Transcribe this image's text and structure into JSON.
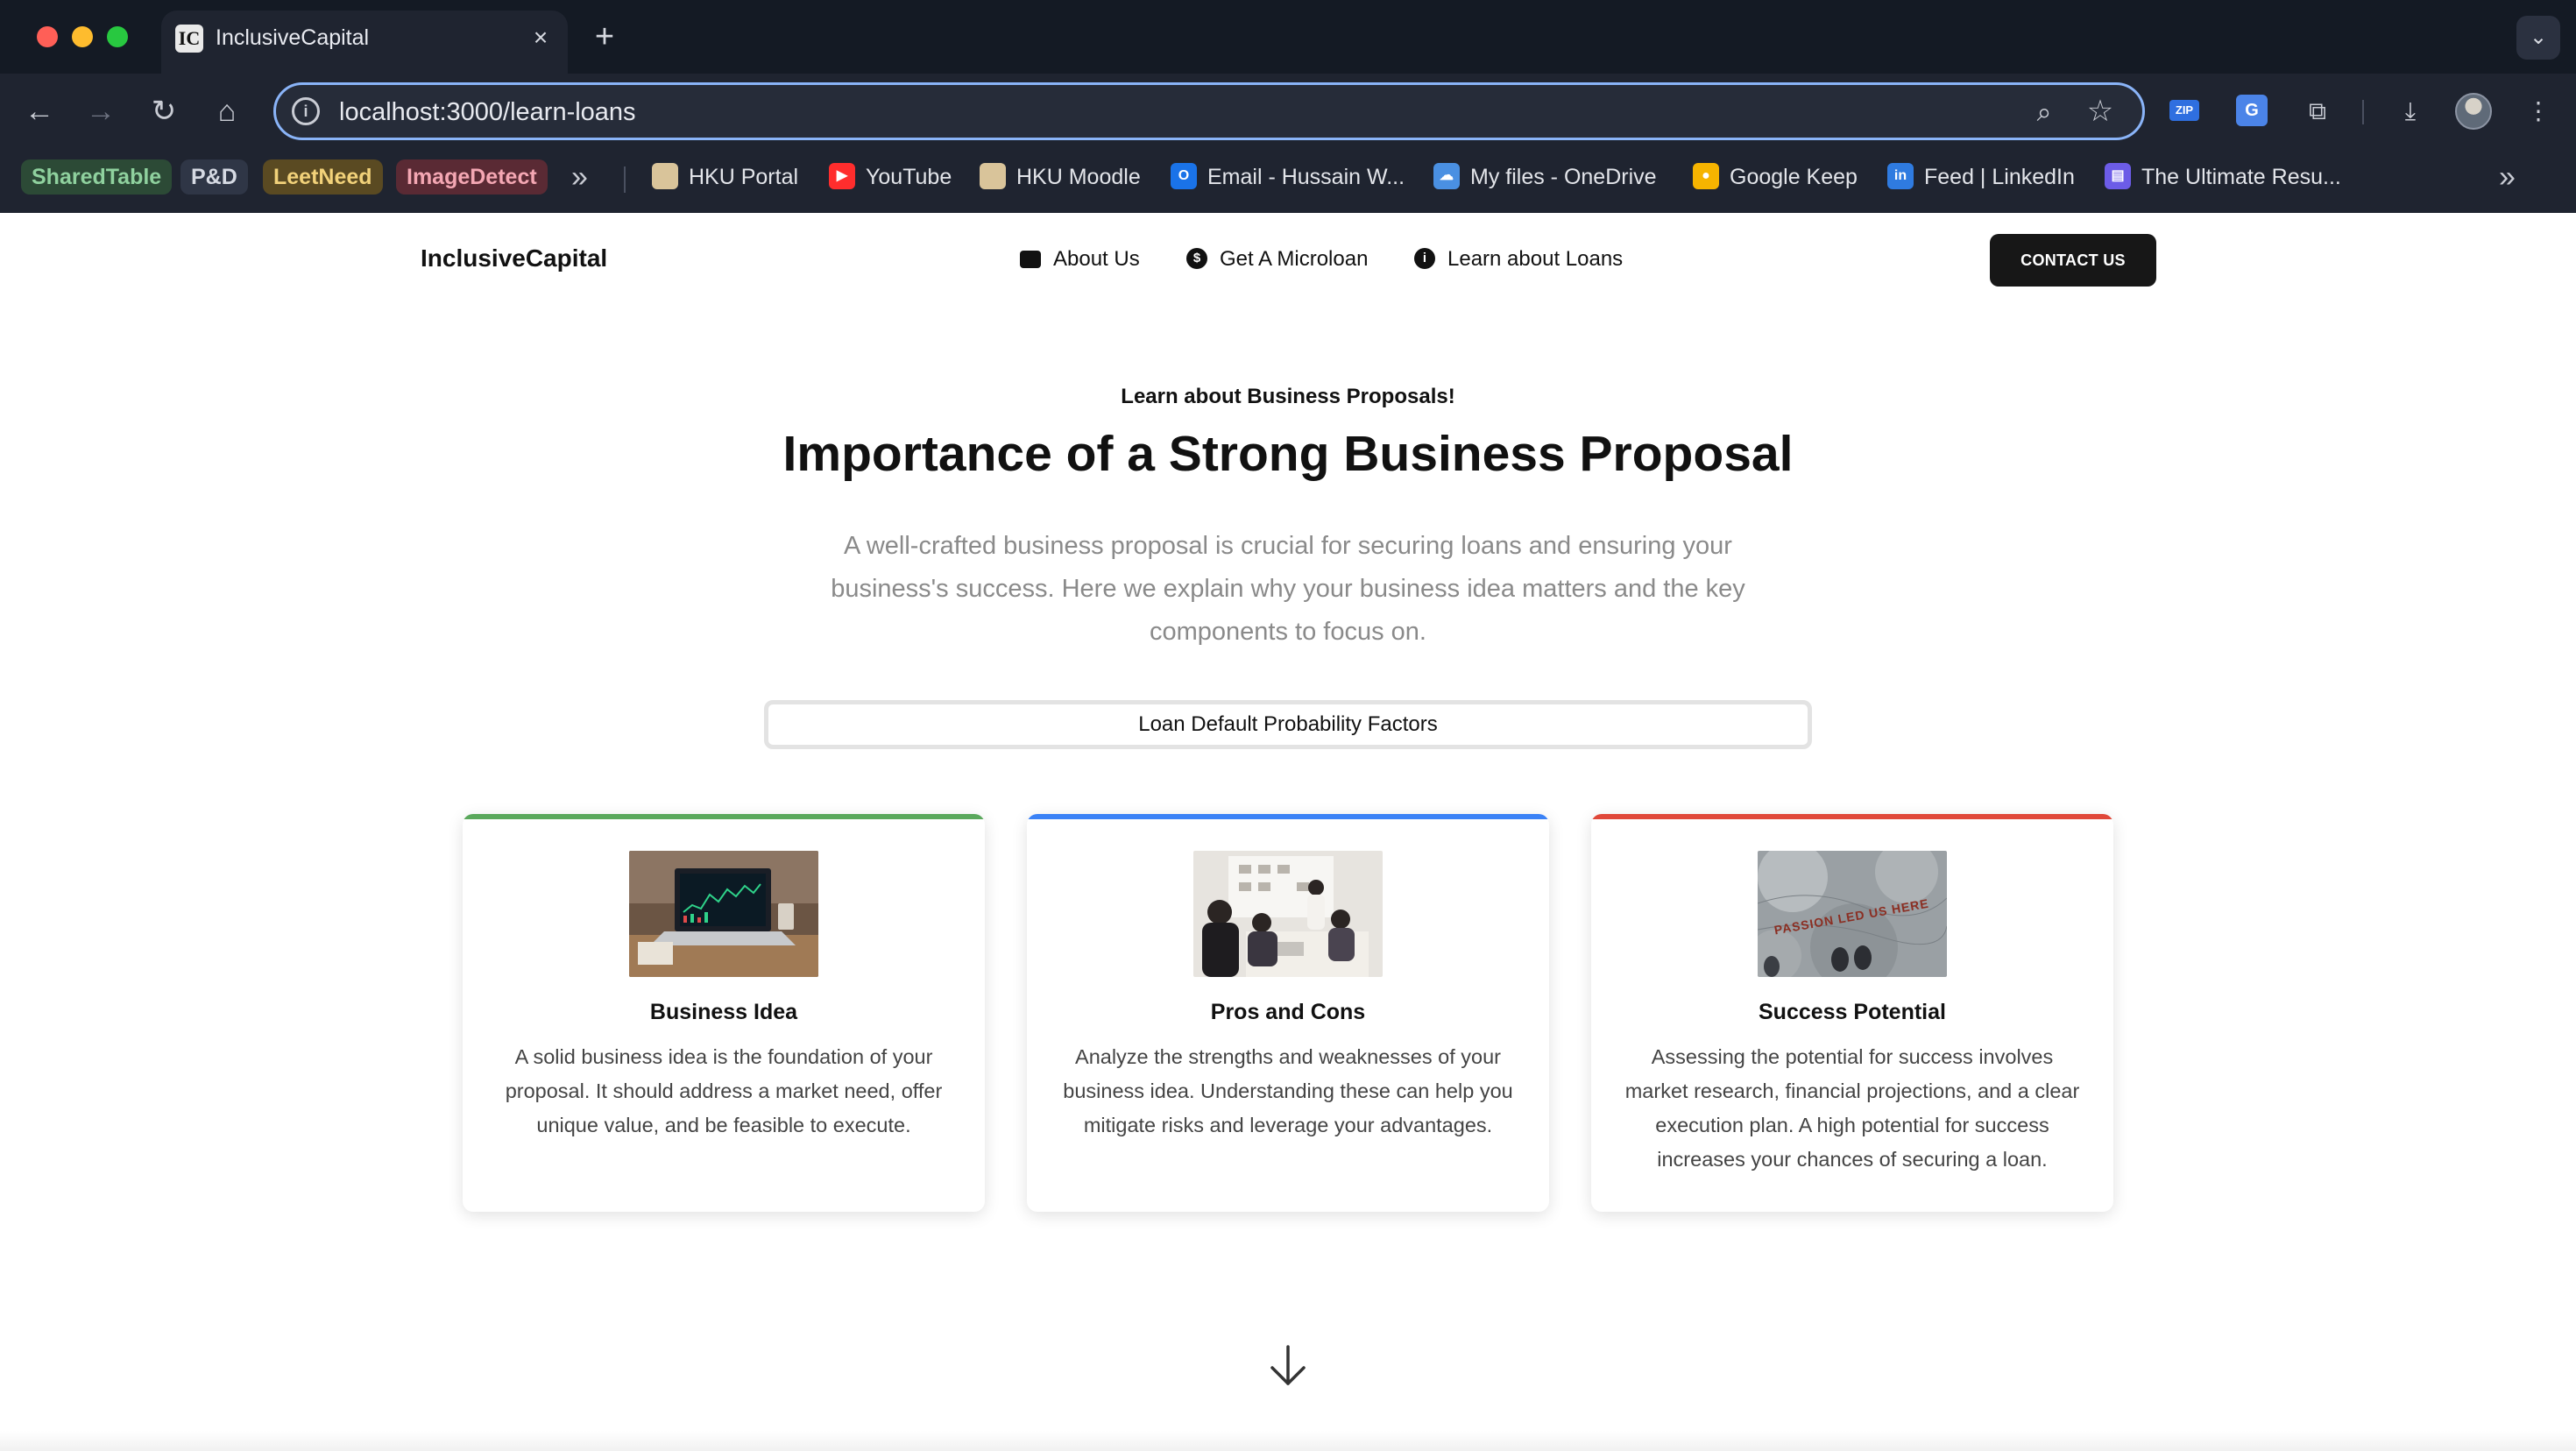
{
  "browser": {
    "tab_title": "InclusiveCapital",
    "tab_favicon_text": "IC",
    "url": "localhost:3000/learn-loans",
    "bookmarks_pills": [
      {
        "label": "SharedTable",
        "color": "#8fd19e",
        "bg": "#2c4a36"
      },
      {
        "label": "P&D",
        "color": "#d6dae3",
        "bg": "#2f3646"
      },
      {
        "label": "LeetNeed",
        "color": "#f2d27a",
        "bg": "#5a4a22"
      },
      {
        "label": "ImageDetect",
        "color": "#f4a7b3",
        "bg": "#5a2a34"
      }
    ],
    "bookmarks": [
      {
        "label": "HKU Portal",
        "icon": "hku-portal-icon",
        "color": "#d9c49a"
      },
      {
        "label": "YouTube",
        "icon": "youtube-icon",
        "color": "#ff2d2d"
      },
      {
        "label": "HKU Moodle",
        "icon": "hku-moodle-icon",
        "color": "#d9c49a"
      },
      {
        "label": "Email - Hussain W...",
        "icon": "outlook-icon",
        "color": "#1a73e8"
      },
      {
        "label": "My files - OneDrive",
        "icon": "onedrive-icon",
        "color": "#4a90e2"
      },
      {
        "label": "Google Keep",
        "icon": "google-keep-icon",
        "color": "#f6b400"
      },
      {
        "label": "Feed | LinkedIn",
        "icon": "linkedin-icon",
        "color": "#2f7be0"
      },
      {
        "label": "The Ultimate Resu...",
        "icon": "resume-icon",
        "color": "#6c5ce7"
      }
    ],
    "ext_zip_label": "ZIP",
    "ext_translate_label": "G"
  },
  "site": {
    "brand": "InclusiveCapital",
    "nav": [
      {
        "label": "About Us",
        "icon": "briefcase-icon"
      },
      {
        "label": "Get A Microloan",
        "icon": "dollar-circle-icon"
      },
      {
        "label": "Learn about Loans",
        "icon": "info-circle-icon"
      }
    ],
    "contact_label": "CONTACT US"
  },
  "hero": {
    "kicker": "Learn about Business Proposals!",
    "heading": "Importance of a Strong Business Proposal",
    "intro": "A well-crafted business proposal is crucial for securing loans and ensuring your business's success. Here we explain why your business idea matters and the key components to focus on.",
    "factors_button": "Loan Default Probability Factors"
  },
  "cards": [
    {
      "title": "Business Idea",
      "description": "A solid business idea is the foundation of your proposal. It should address a market need, offer unique value, and be feasible to execute.",
      "accent": "#5aa85c"
    },
    {
      "title": "Pros and Cons",
      "description": "Analyze the strengths and weaknesses of your business idea. Understanding these can help you mitigate risks and leverage your advantages.",
      "accent": "#3b82f6"
    },
    {
      "title": "Success Potential",
      "description": "Assessing the potential for success involves market research, financial projections, and a clear execution plan. A high potential for success increases your chances of securing a loan.",
      "accent": "#e0483a",
      "image_text": "PASSION LED US HERE"
    }
  ]
}
